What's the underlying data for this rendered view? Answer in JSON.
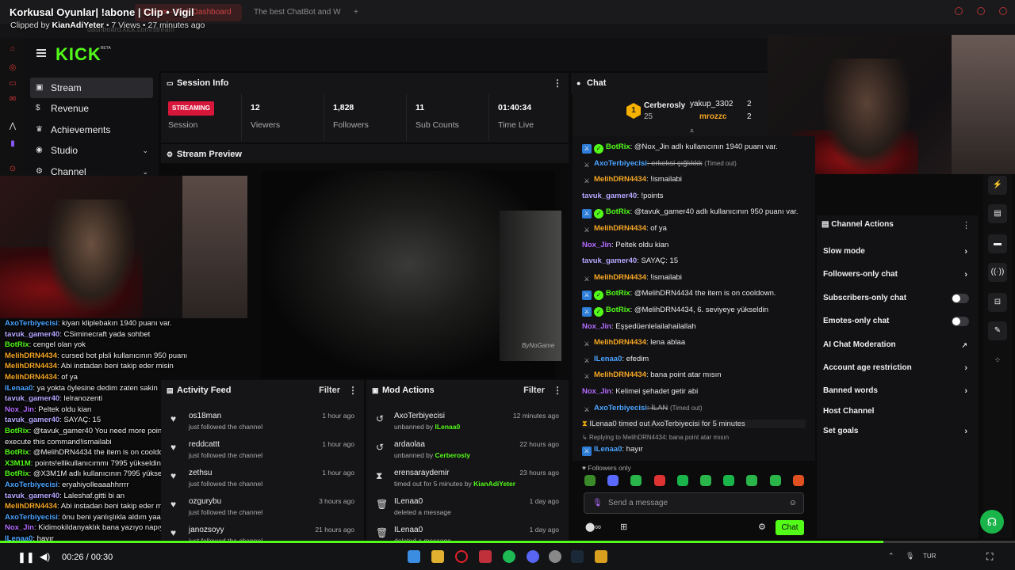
{
  "clip": {
    "title": "Korkusal Oyunlar| !abone | Clip • Vigil",
    "clipped_by_prefix": "Clipped by",
    "clipper": "KianAdiYeter",
    "meta_rest": "• 7 Views • 27 minutes ago"
  },
  "browser": {
    "tab1": "Stream - Kick Dashboard",
    "tab2": "The best ChatBot and W",
    "url": "dashboard.kick.com/stream"
  },
  "logo": {
    "text": "KICK",
    "beta": "BETA"
  },
  "sidebar": {
    "items": [
      {
        "label": "Stream"
      },
      {
        "label": "Revenue"
      },
      {
        "label": "Achievements"
      },
      {
        "label": "Studio"
      },
      {
        "label": "Channel"
      }
    ]
  },
  "session": {
    "title": "Session Info",
    "badge": "STREAMING",
    "session_label": "Session",
    "stats": [
      {
        "value": "12",
        "label": "Viewers"
      },
      {
        "value": "1,828",
        "label": "Followers"
      },
      {
        "value": "11",
        "label": "Sub Counts"
      },
      {
        "value": "01:40:34",
        "label": "Time Live"
      }
    ]
  },
  "preview": {
    "title": "Stream Preview",
    "watermark": "ByNoGame"
  },
  "activity": {
    "title": "Activity Feed",
    "filter": "Filter",
    "rows": [
      {
        "name": "os18man",
        "sub": "just followed the channel",
        "time": "1 hour ago"
      },
      {
        "name": "reddcattt",
        "sub": "just followed the channel",
        "time": "1 hour ago"
      },
      {
        "name": "zethsu",
        "sub": "just followed the channel",
        "time": "1 hour ago"
      },
      {
        "name": "ozgurybu",
        "sub": "just followed the channel",
        "time": "3 hours ago"
      },
      {
        "name": "janozsoyy",
        "sub": "just followed the channel",
        "time": "21 hours ago"
      }
    ]
  },
  "mod": {
    "title": "Mod Actions",
    "filter": "Filter",
    "rows": [
      {
        "name": "AxoTerbiyecisi",
        "sub_pre": "unbanned by",
        "sub_by": "ILenaa0",
        "time": "12 minutes ago"
      },
      {
        "name": "ardaolaa",
        "sub_pre": "unbanned by",
        "sub_by": "Cerberosly",
        "time": "22 hours ago"
      },
      {
        "name": "erensaraydemir",
        "sub_pre": "timed out for 5 minutes by",
        "sub_by": "KianAdiYeter",
        "time": "23 hours ago"
      },
      {
        "name": "ILenaa0",
        "sub_pre": "deleted a message",
        "sub_by": "",
        "time": "1 day ago"
      },
      {
        "name": "ILenaa0",
        "sub_pre": "deleted a message",
        "sub_by": "",
        "time": "1 day ago"
      }
    ]
  },
  "chat": {
    "title": "Chat",
    "leaderboard": {
      "rank": "1",
      "top_user": "Cerberosly",
      "top_count": "25",
      "user2": "yakup_3302",
      "user2_count": "2",
      "user3": "mrozzc",
      "user3_count": "2"
    },
    "messages": [
      {
        "user": "BotRix",
        "color": "#53fc18",
        "badge": "bot",
        "text": ": @Nox_Jin adlı kullanıcının 1940 puanı var."
      },
      {
        "user": "AxoTerbiyecisi",
        "color": "#4aa3ff",
        "badge": "mod",
        "text": ": erkeksi çığlıkkk",
        "note": "(Timed out)"
      },
      {
        "user": "MelihDRN4434",
        "color": "#f5a623",
        "badge": "mod",
        "text": ": !ismailabi"
      },
      {
        "user": "tavuk_gamer40",
        "color": "#b7a7ff",
        "badge": "",
        "text": ": !points"
      },
      {
        "user": "BotRix",
        "color": "#53fc18",
        "badge": "bot",
        "text": ": @tavuk_gamer40 adlı kullanıcının 950 puanı var."
      },
      {
        "user": "MelihDRN4434",
        "color": "#f5a623",
        "badge": "mod",
        "text": ": of ya"
      },
      {
        "user": "Nox_Jin",
        "color": "#b36bff",
        "badge": "",
        "text": ": Peltek oldu kian"
      },
      {
        "user": "tavuk_gamer40",
        "color": "#b7a7ff",
        "badge": "",
        "text": ": SAYAÇ: 15"
      },
      {
        "user": "MelihDRN4434",
        "color": "#f5a623",
        "badge": "mod",
        "text": ": !ismailabi"
      },
      {
        "user": "BotRix",
        "color": "#53fc18",
        "badge": "bot",
        "text": ": @MelihDRN4434 the item is on cooldown."
      },
      {
        "user": "BotRix",
        "color": "#53fc18",
        "badge": "bot",
        "text": ": @MelihDRN4434, 6. seviyeye yükseldin"
      },
      {
        "user": "Nox_Jin",
        "color": "#b36bff",
        "badge": "",
        "text": ": Eşşedüenlelailahailallah"
      },
      {
        "user": "MelihDRN4434",
        "color": "#f5a623",
        "badge": "mod",
        "text": ": lena ablaa"
      },
      {
        "user": "ILenaa0",
        "color": "#4aa3ff",
        "badge": "mod",
        "text": ": efedim"
      },
      {
        "user": "MelihDRN4434",
        "color": "#f5a623",
        "badge": "mod",
        "text": ": bana point atar mısın"
      },
      {
        "user": "Nox_Jin",
        "color": "#b36bff",
        "badge": "",
        "text": ": Kelimei şehadet getir abi"
      },
      {
        "user": "AxoTerbiyecisi",
        "color": "#4aa3ff",
        "badge": "mod",
        "text": ": İLAN",
        "note": "(Timed out)"
      }
    ],
    "timeout_notice": "ILenaa0 timed out AxoTerbiyecisi for 5 minutes",
    "reply_to": "Replying to MelihDRN4434: bana point atar mısın",
    "last_user": "ILenaa0",
    "last_text": ": hayır",
    "followers_only": "Followers only",
    "input_placeholder": "Send a message",
    "send_label": "Chat"
  },
  "channel_actions": {
    "title": "Channel Actions",
    "items": [
      {
        "label": "Slow mode",
        "control": "chevron"
      },
      {
        "label": "Followers-only chat",
        "control": "chevron"
      },
      {
        "label": "Subscribers-only chat",
        "control": "toggle"
      },
      {
        "label": "Emotes-only chat",
        "control": "toggle"
      },
      {
        "label": "AI Chat Moderation",
        "control": "external"
      },
      {
        "label": "Account age restriction",
        "control": "chevron"
      },
      {
        "label": "Banned words",
        "control": "chevron"
      },
      {
        "label": "Host Channel",
        "control": "none"
      },
      {
        "label": "Set goals",
        "control": "chevron"
      }
    ]
  },
  "overlay_chat": [
    {
      "user": "AxoTerbiyecisi",
      "text": ": kiyarı kliplebakın 1940 puanı var.",
      "color": "#4aa3ff"
    },
    {
      "user": "tavuk_gamer40",
      "text": ": CSiminecraft yada sohbet",
      "color": "#b7a7ff"
    },
    {
      "user": "BotRix",
      "text": ": cengel olan yok",
      "color": "#53fc18"
    },
    {
      "user": "MelihDRN4434",
      "text": ": cursed bot plsli kullanıcının 950 puanı",
      "color": "#f5a623"
    },
    {
      "user": "MelihDRN4434",
      "text": ": Abi instadan beni takip eder misin",
      "color": "#f5a623"
    },
    {
      "user": "MelihDRN4434",
      "text": ": of ya",
      "color": "#f5a623"
    },
    {
      "user": "ILenaa0",
      "text": ": ya yokta öylesine dedim zaten sakin",
      "color": "#4aa3ff"
    },
    {
      "user": "tavuk_gamer40",
      "text": ": lelranozenti",
      "color": "#b7a7ff"
    },
    {
      "user": "Nox_Jin",
      "text": ": Peltek oldu kian",
      "color": "#b36bff"
    },
    {
      "user": "tavuk_gamer40",
      "text": ": SAYAÇ: 15",
      "color": "#b7a7ff"
    },
    {
      "user": "BotRix",
      "text": ": @tavuk_gamer40 You need more points to",
      "color": "#53fc18"
    },
    {
      "user": "",
      "text": "execute this command!ismailabi",
      "color": "#eee"
    },
    {
      "user": "BotRix",
      "text": ": @MelihDRN4434 the item is on cooldown.",
      "color": "#53fc18"
    },
    {
      "user": "X3M1M",
      "text": ": points!ellikullanıcımmı 7995 yükseldin",
      "color": "#53fc18"
    },
    {
      "user": "BotRix",
      "text": ": @X3M1M adlı kullanıcının 7995 yükseldin",
      "color": "#53fc18"
    },
    {
      "user": "AxoTerbiyecisi",
      "text": ": eryahiyolleaaahhrrrr",
      "color": "#4aa3ff"
    },
    {
      "user": "tavuk_gamer40",
      "text": ": Laleshaf.gitti bi an",
      "color": "#b7a7ff"
    },
    {
      "user": "MelihDRN4434",
      "text": ": Abi instadan beni takip eder misin plis",
      "color": "#f5a623"
    },
    {
      "user": "AxoTerbiyecisi",
      "text": ": önu beni yanlışlıkla aldım yaa",
      "color": "#4aa3ff"
    },
    {
      "user": "Nox_Jin",
      "text": ": Kidimokildanyaklık bana yazıyo napıyım",
      "color": "#b36bff"
    },
    {
      "user": "ILenaa0",
      "text": ": hayır",
      "color": "#4aa3ff"
    }
  ],
  "player": {
    "time": "00:26 / 00:30",
    "progress": 0.87
  },
  "taskbar": {
    "lang": "TUR",
    "clock": "9:??"
  }
}
